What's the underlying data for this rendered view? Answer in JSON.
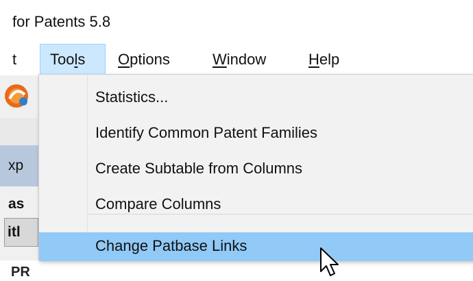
{
  "window": {
    "title_partial": "for Patents 5.8"
  },
  "menubar": {
    "items": [
      {
        "label": "t",
        "active": false
      },
      {
        "label": "Tools",
        "active": true
      },
      {
        "label": "Options",
        "active": false
      },
      {
        "label": "Window",
        "active": false
      },
      {
        "label": "Help",
        "active": false
      }
    ]
  },
  "left_panel": {
    "row1_text": "xp",
    "row2_text": "as",
    "title_cell_text": "itl",
    "bottom_text": "PR"
  },
  "tools_menu": {
    "items": [
      {
        "label": "Statistics...",
        "highlighted": false
      },
      {
        "label": "Identify Common Patent Families",
        "highlighted": false
      },
      {
        "label": "Create Subtable from Columns",
        "highlighted": false
      },
      {
        "label": "Compare Columns",
        "highlighted": false
      },
      {
        "label": "Change Patbase Links",
        "highlighted": true
      }
    ]
  },
  "colors": {
    "highlight": "#91c9f7",
    "menu_active": "#cce8ff",
    "dropdown_bg": "#f2f2f2"
  },
  "icons": {
    "toolbar_icon": "app-orange-logo-icon",
    "cursor": "mouse-pointer-icon"
  }
}
